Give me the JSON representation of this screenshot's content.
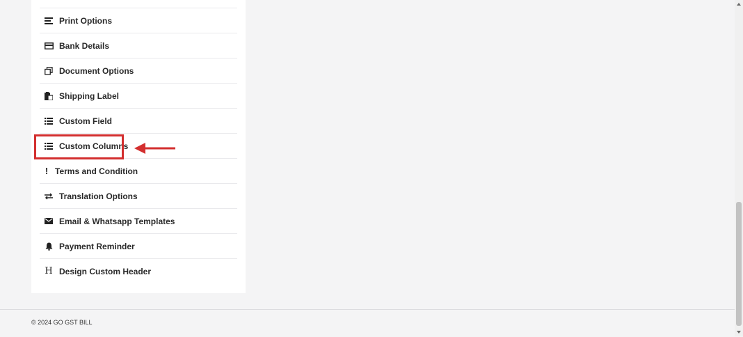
{
  "menu": {
    "items": [
      {
        "label": "Print Options",
        "icon": "align-left-icon"
      },
      {
        "label": "Bank Details",
        "icon": "credit-card-icon"
      },
      {
        "label": "Document Options",
        "icon": "copy-icon"
      },
      {
        "label": "Shipping Label",
        "icon": "clipboard-icon"
      },
      {
        "label": "Custom Field",
        "icon": "list-icon"
      },
      {
        "label": "Custom Columns",
        "icon": "list-icon"
      },
      {
        "label": "Terms and Condition",
        "icon": "exclamation-icon"
      },
      {
        "label": "Translation Options",
        "icon": "exchange-icon"
      },
      {
        "label": "Email & Whatsapp Templates",
        "icon": "envelope-icon"
      },
      {
        "label": "Payment Reminder",
        "icon": "bell-icon"
      },
      {
        "label": "Design Custom Header",
        "icon": "header-icon"
      }
    ]
  },
  "footer": {
    "copyright": "© 2024 GO GST BILL"
  },
  "annotation": {
    "highlight_color": "#d32f2f"
  }
}
